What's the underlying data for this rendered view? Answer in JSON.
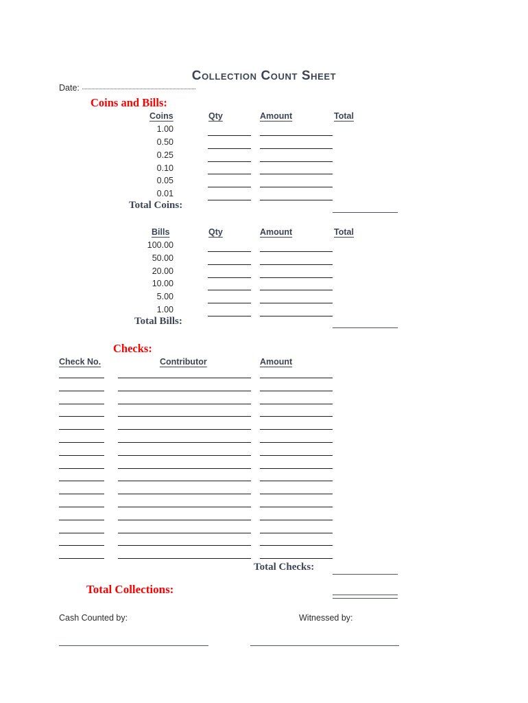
{
  "document": {
    "title": "Collection Count Sheet",
    "title_color": "#3c4454",
    "accent_color": "#ff0000"
  },
  "date_field": {
    "label": "Date:",
    "value": ""
  },
  "coins_and_bills": {
    "heading": "Coins and Bills:",
    "coins": {
      "columns": {
        "denomination": "Coins",
        "qty": "Qty",
        "amount": "Amount",
        "total": "Total "
      },
      "denominations": [
        "1.00",
        "0.50",
        "0.25",
        "0.10",
        "0.05",
        "0.01"
      ],
      "total_label": "Total Coins:",
      "total_value": ""
    },
    "bills": {
      "columns": {
        "denomination": "Bills",
        "qty": "Qty",
        "amount": "Amount",
        "total": "Total "
      },
      "denominations": [
        "100.00",
        "50.00",
        "20.00",
        "10.00",
        "5.00",
        "1.00"
      ],
      "total_label": "Total Bills:",
      "total_value": ""
    }
  },
  "checks": {
    "heading": "Checks:",
    "columns": {
      "check_no": "Check No.",
      "contributor": "Contributor",
      "amount": "Amount"
    },
    "row_count": 15,
    "total_label": "Total Checks:",
    "total_value": ""
  },
  "totals": {
    "total_collections_label": "Total Collections:",
    "total_collections_value": ""
  },
  "footer": {
    "cash_counted_by_label": "Cash Counted by:",
    "cash_counted_by_value": "",
    "witnessed_by_label": "Witnessed by:",
    "witnessed_by_value": ""
  }
}
